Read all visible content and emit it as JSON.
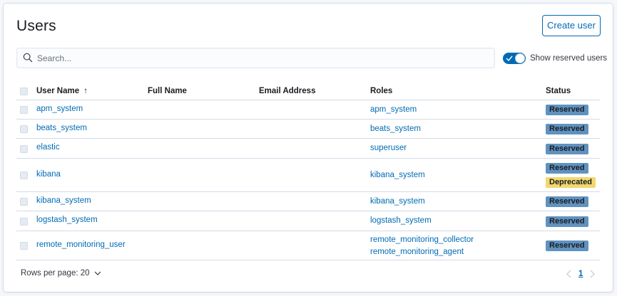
{
  "page": {
    "title": "Users"
  },
  "toolbar": {
    "create_label": "Create user"
  },
  "search": {
    "placeholder": "Search...",
    "value": ""
  },
  "toggle": {
    "label": "Show reserved users",
    "on": true
  },
  "table": {
    "headers": {
      "user_name": "User Name",
      "sort_indicator": "↑",
      "full_name": "Full Name",
      "email": "Email Address",
      "roles": "Roles",
      "status": "Status"
    },
    "rows": [
      {
        "user": "apm_system",
        "full_name": "",
        "email": "",
        "roles": [
          "apm_system"
        ],
        "statuses": [
          "Reserved"
        ]
      },
      {
        "user": "beats_system",
        "full_name": "",
        "email": "",
        "roles": [
          "beats_system"
        ],
        "statuses": [
          "Reserved"
        ]
      },
      {
        "user": "elastic",
        "full_name": "",
        "email": "",
        "roles": [
          "superuser"
        ],
        "statuses": [
          "Reserved"
        ]
      },
      {
        "user": "kibana",
        "full_name": "",
        "email": "",
        "roles": [
          "kibana_system"
        ],
        "statuses": [
          "Reserved",
          "Deprecated"
        ]
      },
      {
        "user": "kibana_system",
        "full_name": "",
        "email": "",
        "roles": [
          "kibana_system"
        ],
        "statuses": [
          "Reserved"
        ]
      },
      {
        "user": "logstash_system",
        "full_name": "",
        "email": "",
        "roles": [
          "logstash_system"
        ],
        "statuses": [
          "Reserved"
        ]
      },
      {
        "user": "remote_monitoring_user",
        "full_name": "",
        "email": "",
        "roles": [
          "remote_monitoring_collector",
          "remote_monitoring_agent"
        ],
        "statuses": [
          "Reserved"
        ]
      }
    ]
  },
  "footer": {
    "rows_per_page_label": "Rows per page: 20",
    "current_page": "1"
  },
  "colors": {
    "accent": "#006bb4",
    "reserved": "#6092c0",
    "deprecated": "#f1d86f",
    "border": "#d3dae6"
  },
  "icons": {
    "search": "search-icon",
    "check": "check-icon",
    "sort": "sort-ascending-icon",
    "chevron": "chevron-down-icon",
    "prev": "chevron-left-icon",
    "next": "chevron-right-icon"
  }
}
